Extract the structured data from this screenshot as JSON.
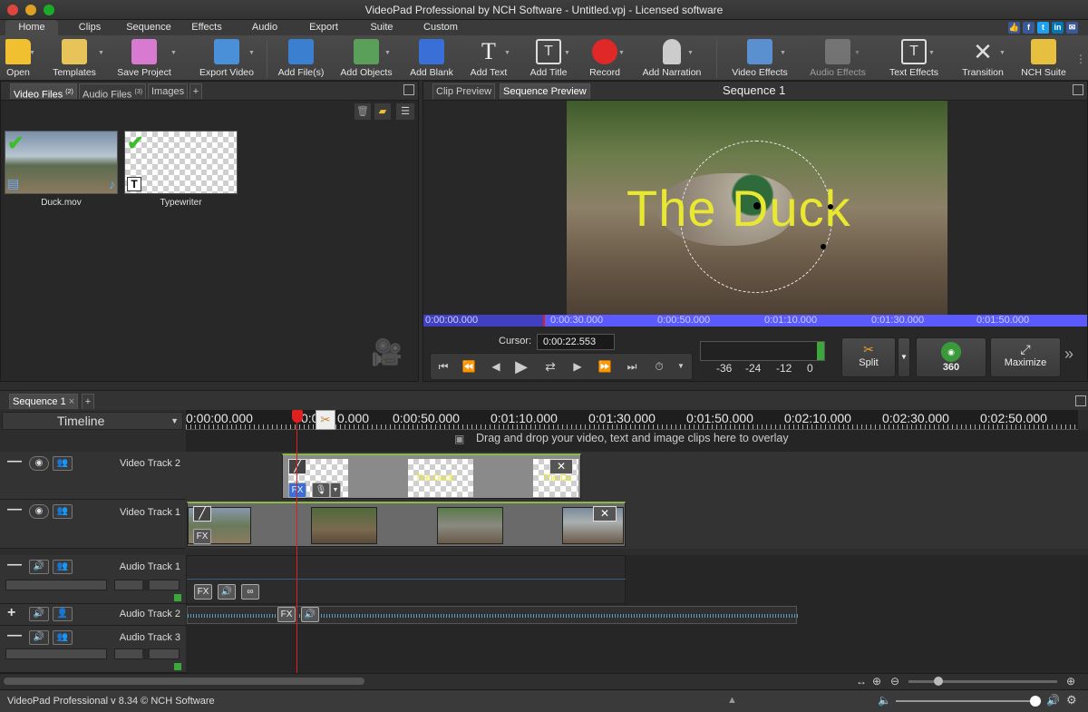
{
  "window": {
    "title": "VideoPad Professional by NCH Software - Untitled.vpj - Licensed software"
  },
  "social": [
    "thumbs-up-icon",
    "facebook-icon",
    "twitter-icon",
    "linkedin-icon",
    "email-icon"
  ],
  "menu": {
    "tabs": [
      "Home",
      "Clips",
      "Sequence",
      "Effects",
      "Audio",
      "Export",
      "Suite",
      "Custom"
    ]
  },
  "toolbar": {
    "open": "Open",
    "templates": "Templates",
    "save_project": "Save Project",
    "export_video": "Export Video",
    "add_files": "Add File(s)",
    "add_objects": "Add Objects",
    "add_blank": "Add Blank",
    "add_text": "Add Text",
    "add_title": "Add Title",
    "record": "Record",
    "add_narration": "Add Narration",
    "video_effects": "Video Effects",
    "audio_effects": "Audio Effects",
    "text_effects": "Text Effects",
    "transition": "Transition",
    "nch_suite": "NCH Suite"
  },
  "bin": {
    "tab_video": "Video Files",
    "tab_video_count": "(2)",
    "tab_audio": "Audio Files",
    "tab_audio_count": "(3)",
    "tab_images": "Images",
    "tab_add": "+",
    "items": [
      {
        "name": "Duck.mov"
      },
      {
        "name": "Typewriter"
      }
    ]
  },
  "preview": {
    "tab_clip": "Clip Preview",
    "tab_sequence": "Sequence Preview",
    "title": "Sequence 1",
    "overlay_text": "The Duck",
    "ruler": [
      "0:00:00.000",
      "0:00:30.000",
      "0:00:50.000",
      "0:01:10.000",
      "0:01:30.000",
      "0:01:50.000"
    ],
    "cursor_label": "Cursor:",
    "cursor_value": "0:00:22.553",
    "meter_labels": [
      "-36",
      "-24",
      "-12",
      "0"
    ],
    "split": "Split",
    "three_sixty": "360",
    "maximize": "Maximize"
  },
  "timeline": {
    "sequence_tab": "Sequence 1",
    "add_tab": "+",
    "mode": "Timeline",
    "ruler": [
      "0:00:00.000",
      "0:0",
      "0.000",
      "0:00:50.000",
      "0:01:10.000",
      "0:01:30.000",
      "0:01:50.000",
      "0:02:10.000",
      "0:02:30.000",
      "0:02:50.000"
    ],
    "drop_hint": "Drag and drop your video, text and image clips here to overlay",
    "tracks": {
      "video2": "Video Track 2",
      "video1": "Video Track 1",
      "audio1": "Audio Track 1",
      "audio2": "Audio Track 2",
      "audio3": "Audio Track 3"
    },
    "title_clip_text": "The Duck",
    "title_clip_text_short": "The Du",
    "fx": "FX"
  },
  "status": {
    "text": "VideoPad Professional v 8.34 © NCH Software"
  },
  "colors": {
    "accent_blue": "#5a5aff",
    "playhead": "#e02020",
    "title_yellow": "#e8e830",
    "green_check": "#3dbd2a"
  }
}
